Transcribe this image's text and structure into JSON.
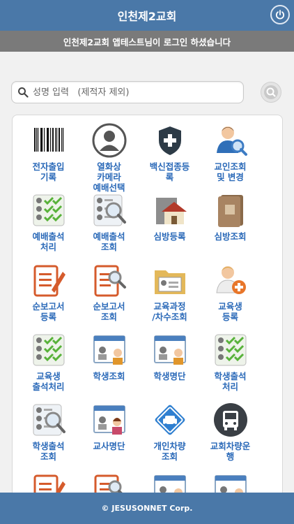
{
  "header": {
    "title": "인천제2교회"
  },
  "notice": {
    "text": "인천제2교회 앱테스트님이 로그인 하셨습니다"
  },
  "search": {
    "placeholder": "성명 입력   (제적자 제외)"
  },
  "menu": [
    {
      "label": "전자출입\n기록",
      "icon": "barcode-icon"
    },
    {
      "label": "열화상\n카메라\n예배선택",
      "icon": "user-avatar-icon"
    },
    {
      "label": "백신접종등\n록",
      "icon": "shield-plus-icon"
    },
    {
      "label": "교인조회\n및 변경",
      "icon": "person-search-icon"
    },
    {
      "label": "예배출석\n처리",
      "icon": "attendance-check-icon"
    },
    {
      "label": "예배출석\n조회",
      "icon": "attendance-search-icon"
    },
    {
      "label": "심방등록",
      "icon": "house-visit-icon"
    },
    {
      "label": "심방조회",
      "icon": "visit-book-icon"
    },
    {
      "label": "순보고서\n등록",
      "icon": "report-write-icon"
    },
    {
      "label": "순보고서\n조회",
      "icon": "report-search-icon"
    },
    {
      "label": "교육과정\n/차수조회",
      "icon": "course-folder-icon"
    },
    {
      "label": "교육생\n등록",
      "icon": "person-add-icon"
    },
    {
      "label": "교육생\n출석처리",
      "icon": "attendance-check-icon"
    },
    {
      "label": "학생조회",
      "icon": "student-board-icon"
    },
    {
      "label": "학생명단",
      "icon": "student-board-icon"
    },
    {
      "label": "학생출석\n처리",
      "icon": "attendance-check-icon"
    },
    {
      "label": "학생출석\n조회",
      "icon": "attendance-search-icon"
    },
    {
      "label": "교사명단",
      "icon": "teacher-board-icon"
    },
    {
      "label": "개인차량\n조회",
      "icon": "car-sign-icon"
    },
    {
      "label": "교회차량운\n행",
      "icon": "bus-icon"
    },
    {
      "label": "",
      "icon": "report-write-icon"
    },
    {
      "label": "",
      "icon": "report-search-icon"
    },
    {
      "label": "",
      "icon": "student-board-icon"
    },
    {
      "label": "",
      "icon": "student-board-icon"
    }
  ],
  "footer": {
    "text": "© JESUSONNET Corp."
  }
}
